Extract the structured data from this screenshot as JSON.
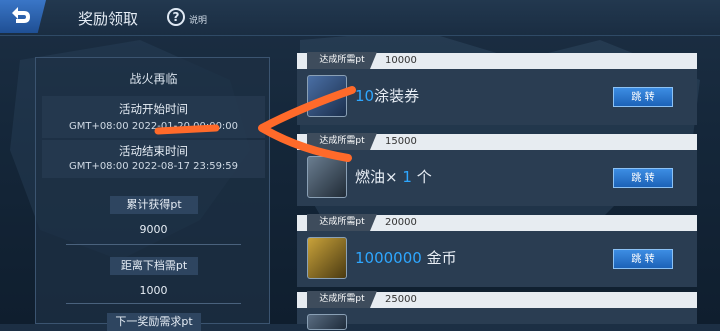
{
  "header": {
    "title": "奖励领取",
    "help_label": "说明",
    "back_icon": "back-arrow-icon",
    "help_icon": "question-circle-icon"
  },
  "event": {
    "name": "战火再临",
    "start_label": "活动开始时间",
    "start_value": "GMT+08:00 2022-01-20 00:00:00",
    "end_label": "活动结束时间",
    "end_value": "GMT+08:00 2022-08-17 23:59:59",
    "earned_label": "累计获得pt",
    "earned_value": "9000",
    "next_label": "距离下档需pt",
    "next_value": "1000",
    "final_label": "下一奖励需求pt"
  },
  "rewards": [
    {
      "req_label": "达成所需pt",
      "req_value": "10000",
      "qty": "10",
      "name": "涂装券",
      "button": "跳 转"
    },
    {
      "req_label": "达成所需pt",
      "req_value": "15000",
      "name": "燃油×",
      "qty": "1",
      "unit": "个",
      "button": "跳 转"
    },
    {
      "req_label": "达成所需pt",
      "req_value": "20000",
      "qty": "1000000",
      "name": "金币",
      "button": "跳 转"
    },
    {
      "req_label": "达成所需pt",
      "req_value": "25000"
    }
  ],
  "colors": {
    "accent_blue": "#2ea7ff",
    "annotation": "#ff6a2a"
  }
}
